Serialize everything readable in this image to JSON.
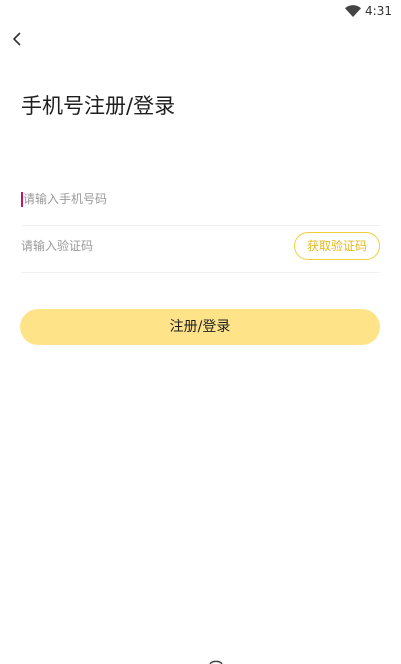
{
  "status_bar": {
    "time": "4:31",
    "wifi_icon": "wifi-icon"
  },
  "header": {
    "back_icon": "chevron-left-icon"
  },
  "page": {
    "title": "手机号注册/登录"
  },
  "form": {
    "phone_placeholder": "请输入手机号码",
    "phone_value": "",
    "code_placeholder": "请输入验证码",
    "code_value": "",
    "get_code_label": "获取验证码",
    "submit_label": "注册/登录"
  },
  "colors": {
    "accent": "#ffe389",
    "accent_border": "#f1cf3b",
    "accent_text": "#e4b81e",
    "caret": "#c2185b"
  }
}
